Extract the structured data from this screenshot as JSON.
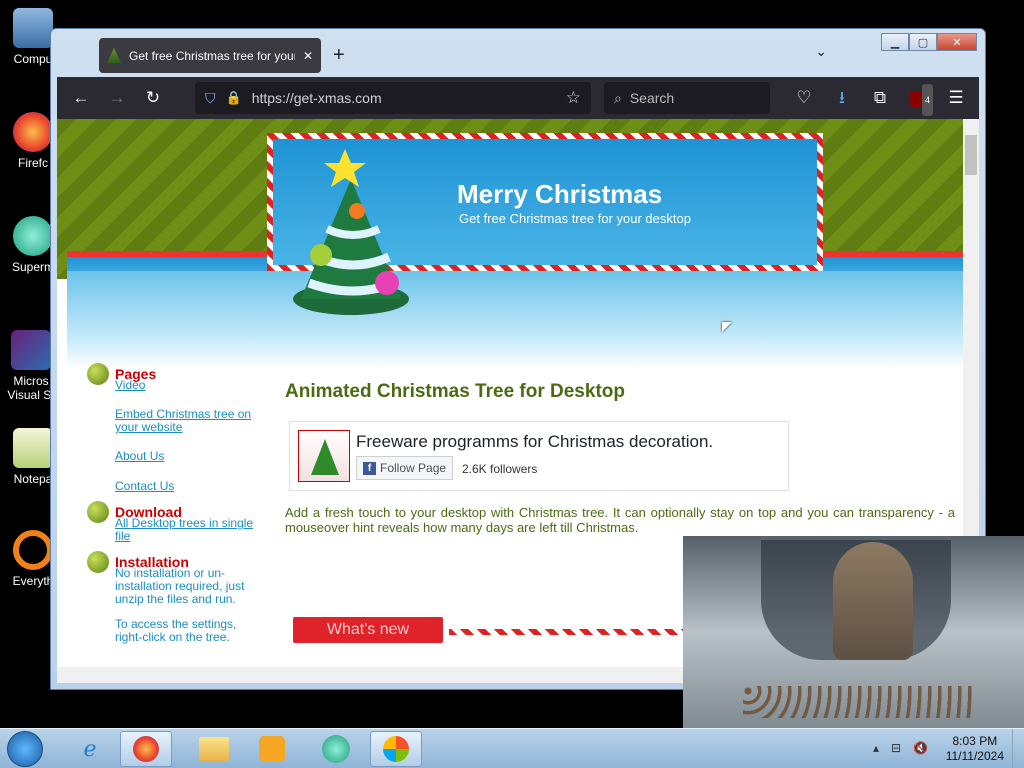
{
  "desktop": {
    "icons": [
      {
        "label": "Compu",
        "icon": "computer-icon"
      },
      {
        "label": "Firefc",
        "icon": "firefox-icon"
      },
      {
        "label": "Superm",
        "icon": "supermium-icon"
      },
      {
        "label": "Micros\nVisual St",
        "icon": "visual-studio-icon"
      },
      {
        "label": "Notepa",
        "icon": "notepad-icon"
      },
      {
        "label": "Everyth",
        "icon": "everything-search-icon"
      }
    ]
  },
  "browser": {
    "tab_title": "Get free Christmas tree for your",
    "new_tab": "+",
    "url": "https://get-xmas.com",
    "search_placeholder": "Search",
    "ublock_badge": "4"
  },
  "page": {
    "header_title": "Merry Christmas",
    "header_subtitle": "Get free Christmas tree for your desktop",
    "sidebar": {
      "pages_heading": "Pages",
      "links": [
        "Video",
        "Embed Christmas tree on your website",
        "About Us",
        "Contact Us"
      ],
      "download_heading": "Download",
      "download_link": "All Desktop trees in single file",
      "installation_heading": "Installation",
      "installation_text1": "No installation or un-installation required, just unzip the files and run.",
      "installation_text2": "To access the settings, right-click on the tree."
    },
    "main_title": "Animated Christmas Tree for Desktop",
    "fb": {
      "title": "Freeware programms for Christmas decoration.",
      "button": "Follow Page",
      "followers": "2.6K followers"
    },
    "description": "Add a fresh touch to your desktop with Christmas tree. It can optionally stay on top and you can transparency - a mouseover hint reveals how many days are left till Christmas.",
    "whats_new": "What's new"
  },
  "taskbar": {
    "time": "8:03 PM",
    "date": "11/11/2024"
  }
}
